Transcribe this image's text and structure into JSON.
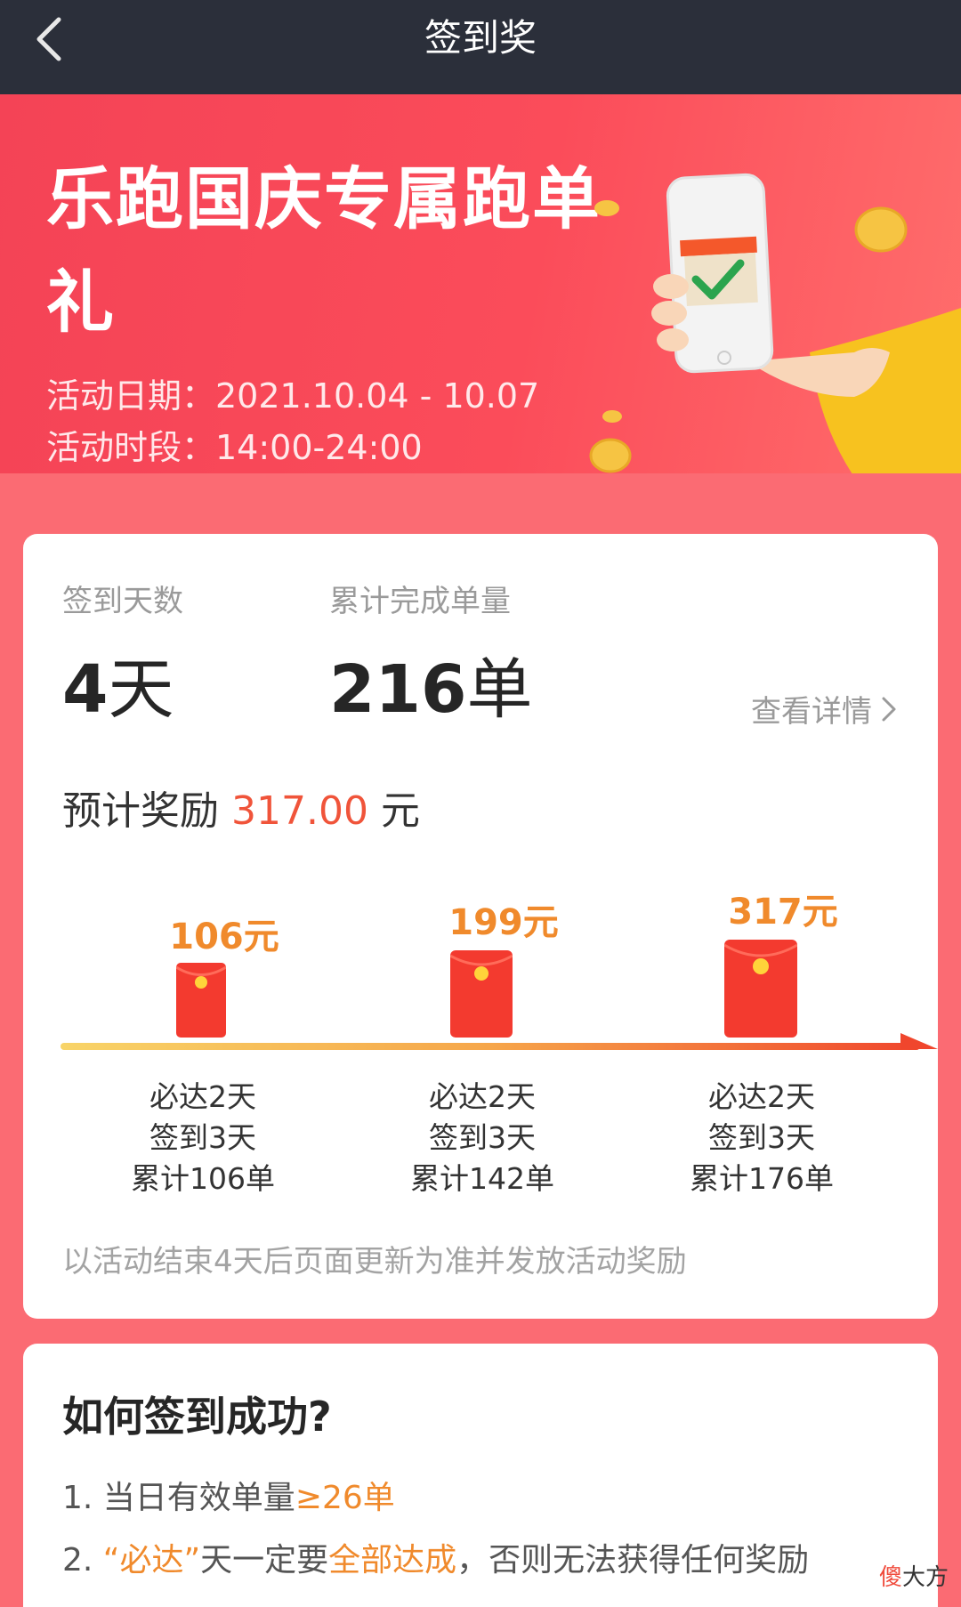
{
  "topbar": {
    "title": "签到奖"
  },
  "banner": {
    "title": "乐跑国庆专属跑单礼",
    "date_line": "活动日期：2021.10.04 - 10.07",
    "time_line": "活动时段：14:00-24:00"
  },
  "stats": {
    "days_label": "签到天数",
    "days_value": "4",
    "days_unit": "天",
    "orders_label": "累计完成单量",
    "orders_value": "216",
    "orders_unit": "单",
    "detail_link": "查看详情"
  },
  "reward": {
    "prefix": "预计奖励",
    "amount": "317.00",
    "suffix": "元"
  },
  "milestones": [
    {
      "amount": "106元",
      "line1": "必达2天",
      "line2": "签到3天",
      "line3": "累计106单"
    },
    {
      "amount": "199元",
      "line1": "必达2天",
      "line2": "签到3天",
      "line3": "累计142单"
    },
    {
      "amount": "317元",
      "line1": "必达2天",
      "line2": "签到3天",
      "line3": "累计176单"
    }
  ],
  "footnote": "以活动结束4天后页面更新为准并发放活动奖励",
  "rules": {
    "title": "如何签到成功?",
    "r1_prefix": "1. 当日有效单量",
    "r1_highlight": "≥26单",
    "r2_prefix": "2. ",
    "r2_hl1": "“必达”",
    "r2_mid": "天一定要",
    "r2_hl2": "全部达成",
    "r2_suffix": "，否则无法获得任何奖励"
  },
  "watermark": {
    "first": "傻",
    "rest": "大方"
  },
  "colors": {
    "topbar_bg": "#2b2f3a",
    "banner_red": "#f44356",
    "page_bg": "#fb6b73",
    "accent_orange": "#f08a2c",
    "reward_red": "#f0543a"
  },
  "icons": {
    "back": "chevron-left-icon",
    "detail_arrow": "chevron-right-icon",
    "envelope": "red-envelope-icon"
  }
}
